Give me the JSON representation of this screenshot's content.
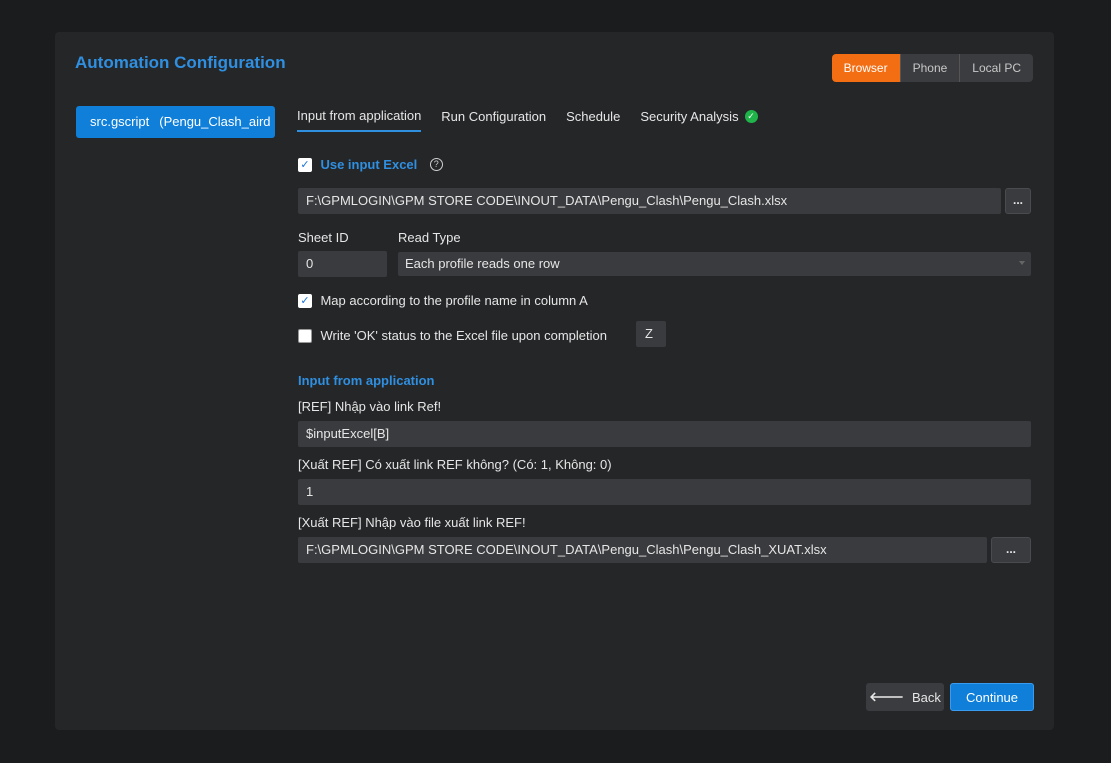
{
  "header": {
    "title": "Automation Configuration",
    "device_modes": [
      {
        "label": "Browser",
        "active": true
      },
      {
        "label": "Phone",
        "active": false
      },
      {
        "label": "Local PC",
        "active": false
      }
    ]
  },
  "sidebar": {
    "script_name": "src.gscript",
    "script_project": "(Pengu_Clash_aird"
  },
  "tabs": [
    {
      "label": "Input from application",
      "active": true
    },
    {
      "label": "Run Configuration",
      "active": false
    },
    {
      "label": "Schedule",
      "active": false
    },
    {
      "label": "Security Analysis",
      "active": false,
      "badge_icon": "check-circle-icon"
    }
  ],
  "excel": {
    "use_input_label": "Use input Excel",
    "use_input_checked": true,
    "file_path": "F:\\GPMLOGIN\\GPM STORE CODE\\INOUT_DATA\\Pengu_Clash\\Pengu_Clash.xlsx",
    "browse_label": "...",
    "sheet_id_label": "Sheet ID",
    "sheet_id_value": "0",
    "read_type_label": "Read Type",
    "read_type_value": "Each profile reads one row",
    "map_label": "Map according to the profile name in column A",
    "map_checked": true,
    "write_ok_label": "Write 'OK' status to the Excel file upon completion",
    "write_ok_checked": false,
    "write_ok_column": "Z"
  },
  "app_inputs": {
    "section_title": "Input from application",
    "ref_label": "[REF] Nhập vào link Ref!",
    "ref_value": "$inputExcel[B]",
    "export_flag_label": "[Xuất REF] Có xuất link REF không? (Có: 1, Không: 0)",
    "export_flag_value": "1",
    "export_file_label": "[Xuất REF] Nhập vào file xuất link REF!",
    "export_file_value": "F:\\GPMLOGIN\\GPM STORE CODE\\INOUT_DATA\\Pengu_Clash\\Pengu_Clash_XUAT.xlsx",
    "browse_label": "..."
  },
  "footer": {
    "back_label": "Back",
    "continue_label": "Continue"
  },
  "colors": {
    "accent": "#0f7fd9",
    "active_mode": "#f36d12",
    "success": "#1fb34a"
  }
}
